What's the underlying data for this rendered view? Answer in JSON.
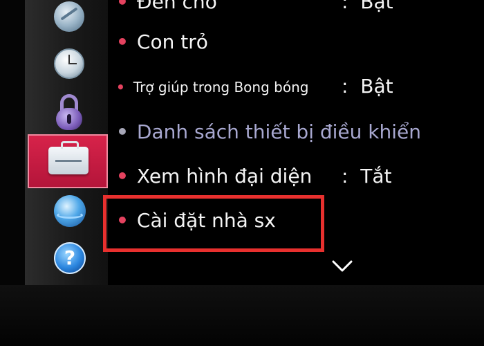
{
  "menu": {
    "items": [
      {
        "label": "Đèn chờ",
        "value": "Bật"
      },
      {
        "label": "Con trỏ"
      },
      {
        "label": "Trợ giúp trong Bong bóng",
        "value": "Bật"
      },
      {
        "label": "Danh sách thiết bị điều khiển"
      },
      {
        "label": "Xem hình đại diện",
        "value": "Tắt"
      },
      {
        "label": "Cài đặt nhà sx"
      }
    ],
    "colon": ":"
  },
  "sidebar": {
    "icons": [
      "satellite-icon",
      "clock-icon",
      "lock-icon",
      "toolbox-icon",
      "network-globe-icon",
      "help-icon"
    ],
    "help_glyph": "?"
  },
  "colors": {
    "bullet": "#e4425f",
    "selected_tab": "#c81c42",
    "highlight_box": "#e8302e"
  }
}
